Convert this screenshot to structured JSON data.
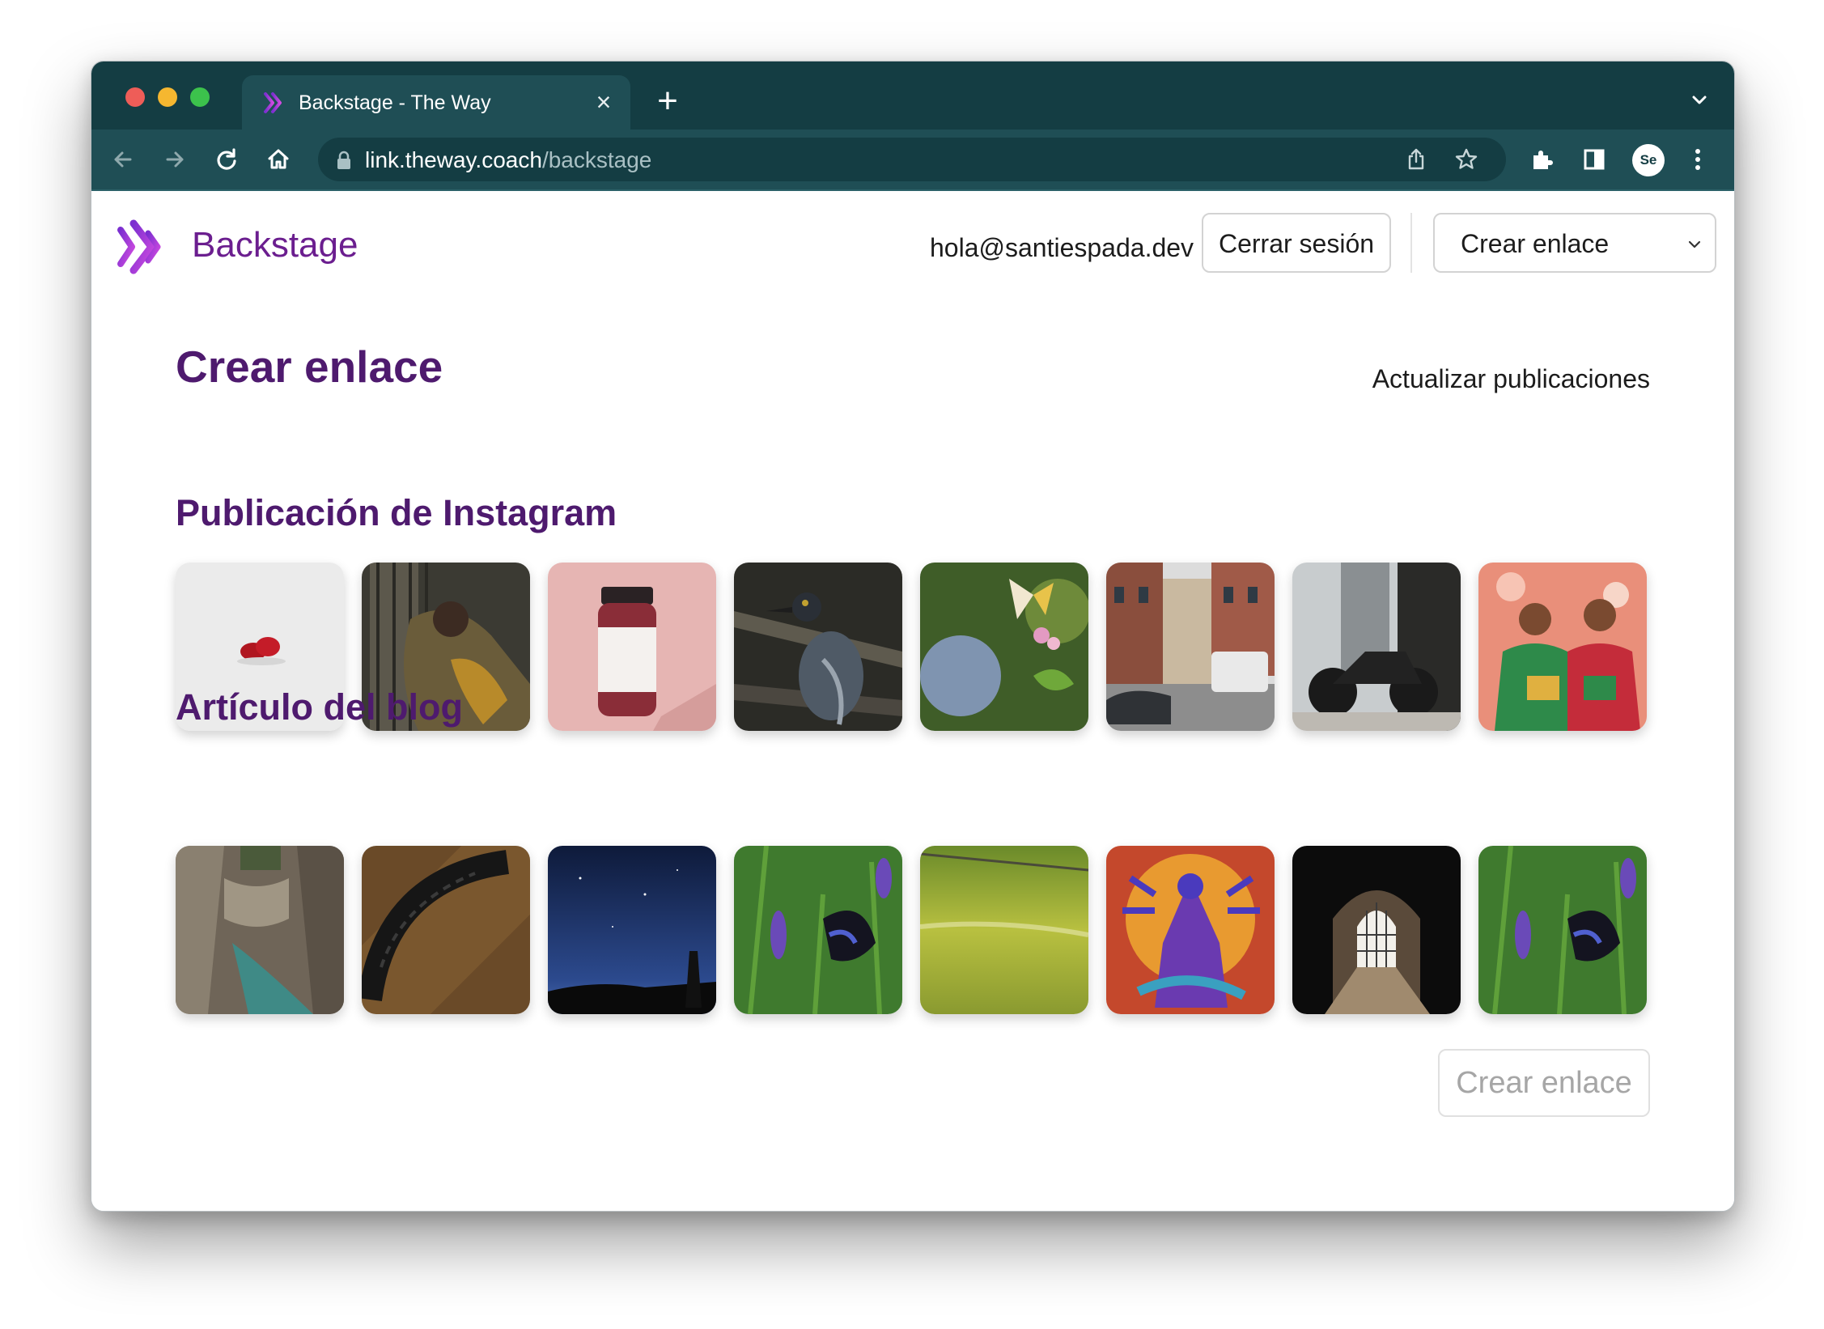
{
  "browser": {
    "tab": {
      "title": "Backstage - The Way",
      "favicon": "backstage-logo-icon",
      "close_icon": "close-icon"
    },
    "new_tab_icon": "plus-icon",
    "tab_list_icon": "chevron-down-icon",
    "nav": {
      "back_icon": "arrow-left-icon",
      "forward_icon": "arrow-right-icon",
      "reload_icon": "reload-icon",
      "home_icon": "home-icon"
    },
    "address": {
      "host": "link.theway.coach",
      "path": "/backstage",
      "lock_icon": "lock-icon"
    },
    "omnibox_icons": [
      "share-icon",
      "star-icon"
    ],
    "toolbar_icons": [
      "extensions-icon",
      "side-panel-icon",
      "menu-dots-icon"
    ],
    "profile_initials": "Se"
  },
  "header": {
    "brand": "Backstage",
    "email": "hola@santiespada.dev",
    "logout_label": "Cerrar sesión",
    "select_value": "Crear enlace"
  },
  "main": {
    "title": "Crear enlace",
    "refresh_link": "Actualizar publicaciones",
    "sections": [
      {
        "title": "Publicación de Instagram",
        "thumbnails": [
          "raspberries-photo",
          "woman-window-photo",
          "supplement-jar-photo",
          "heron-photo",
          "butterfly-flowers-photo",
          "street-houses-photo",
          "motorcycle-photo",
          "dancers-photo"
        ]
      },
      {
        "title": "Artículo del blog",
        "thumbnails": [
          "canyon-river-photo",
          "bike-tire-photo",
          "night-sky-photo",
          "butterfly-lavender-photo",
          "sunlit-stream-photo",
          "deity-statue-photo",
          "church-window-photo",
          "butterfly-lavender-photo"
        ]
      }
    ],
    "create_button": "Crear enlace"
  },
  "colors": {
    "chrome_dark": "#143d43",
    "chrome_toolbar": "#1f4e55",
    "brand_purple": "#6b1e8f",
    "heading_purple": "#4e1a6e",
    "logo_gradient": [
      "#7b2fd0",
      "#d04be0"
    ]
  }
}
